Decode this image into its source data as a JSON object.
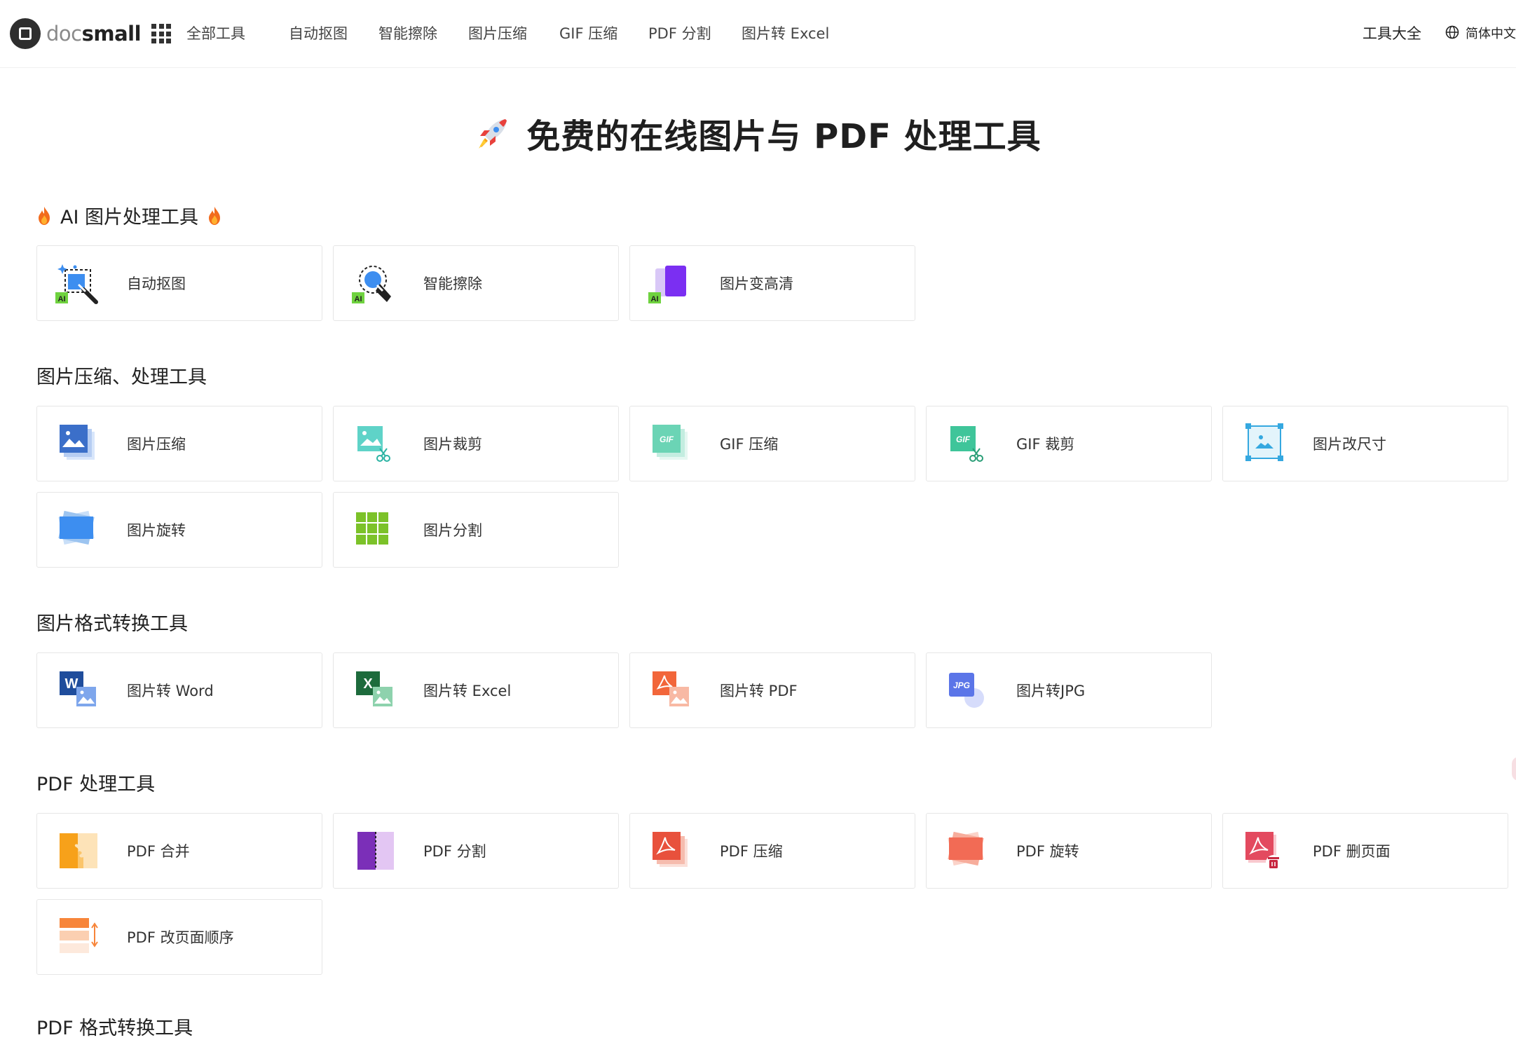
{
  "header": {
    "logo": {
      "doc": "doc",
      "small": "small"
    },
    "nav": [
      "全部工具",
      "自动抠图",
      "智能擦除",
      "图片压缩",
      "GIF 压缩",
      "PDF 分割",
      "图片转 Excel"
    ],
    "tools_link": "工具大全",
    "language": "简体中文"
  },
  "hero": {
    "title": "免费的在线图片与 PDF 处理工具"
  },
  "sections": [
    {
      "title": "AI 图片处理工具",
      "items": [
        "自动抠图",
        "智能擦除",
        "图片变高清"
      ]
    },
    {
      "title": "图片压缩、处理工具",
      "items": [
        "图片压缩",
        "图片裁剪",
        "GIF 压缩",
        "GIF 裁剪",
        "图片改尺寸",
        "图片旋转",
        "图片分割"
      ]
    },
    {
      "title": "图片格式转换工具",
      "items": [
        "图片转 Word",
        "图片转 Excel",
        "图片转 PDF",
        "图片转JPG"
      ]
    },
    {
      "title": "PDF 处理工具",
      "items": [
        "PDF 合并",
        "PDF 分割",
        "PDF 压缩",
        "PDF 旋转",
        "PDF 删页面",
        "PDF 改页面顺序"
      ]
    },
    {
      "title": "PDF 格式转换工具"
    }
  ],
  "icons": {
    "ai_badge": "AI",
    "gif_badge": "GIF",
    "word_badge": "W",
    "excel_badge": "X",
    "jpg_badge": "JPG"
  },
  "colors": {
    "accent_blue": "#3d8ef0",
    "ai_green": "#6fd23f",
    "purple": "#7b2ff2",
    "pdf_red": "#e8513c",
    "orange": "#f7a11a"
  }
}
